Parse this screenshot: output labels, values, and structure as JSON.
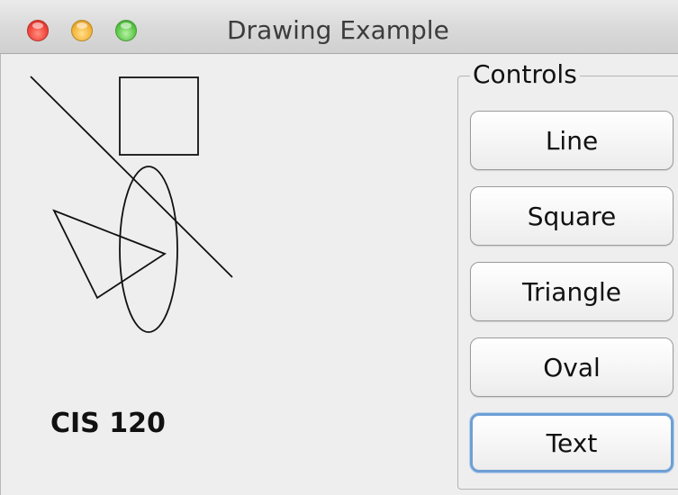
{
  "window": {
    "title": "Drawing Example"
  },
  "titlebar": {
    "buttons": [
      {
        "name": "close",
        "color": "#f2463c"
      },
      {
        "name": "minimize",
        "color": "#f5b43b"
      },
      {
        "name": "zoom",
        "color": "#5ec94b"
      }
    ]
  },
  "canvas": {
    "text": "CIS 120",
    "shapes": [
      "line",
      "square",
      "triangle",
      "oval",
      "text"
    ]
  },
  "controls": {
    "title": "Controls",
    "buttons": [
      {
        "label": "Line"
      },
      {
        "label": "Square"
      },
      {
        "label": "Triangle"
      },
      {
        "label": "Oval"
      },
      {
        "label": "Text",
        "focused": true
      }
    ]
  },
  "colors": {
    "focus_ring": "#6e9fd4",
    "window_bg": "#eeeeee"
  }
}
